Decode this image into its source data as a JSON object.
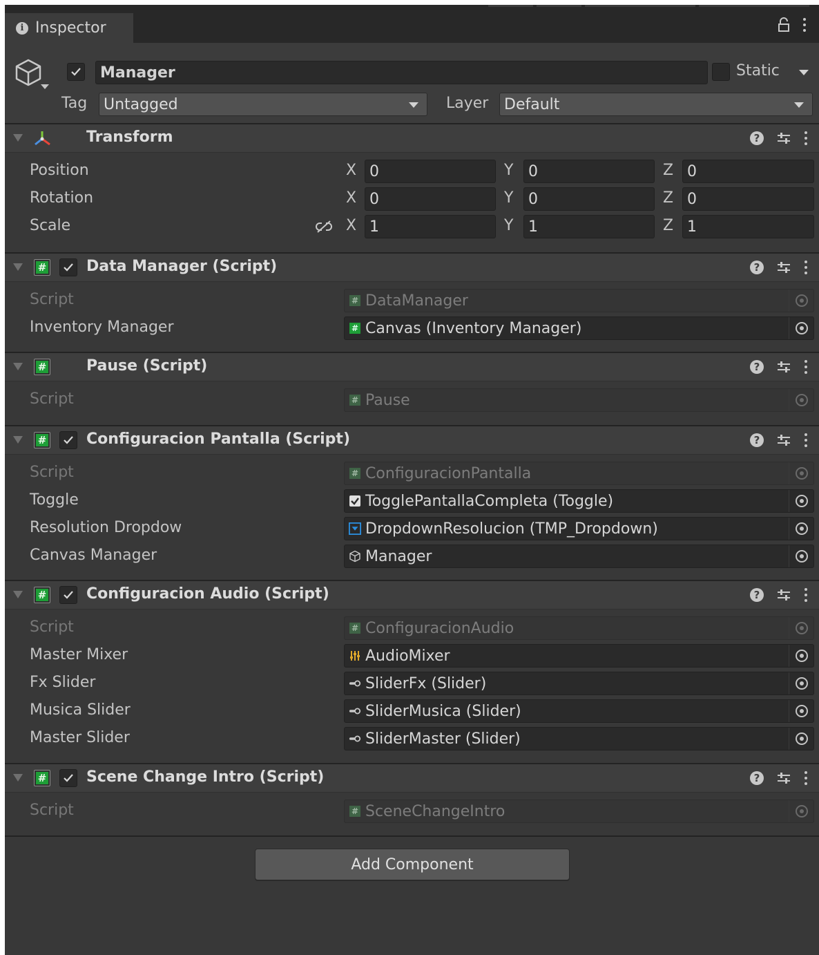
{
  "tab": {
    "title": "Inspector"
  },
  "gameobject": {
    "name": "Manager",
    "active": true,
    "static_label": "Static",
    "tag_label": "Tag",
    "tag_value": "Untagged",
    "layer_label": "Layer",
    "layer_value": "Default"
  },
  "transform": {
    "title": "Transform",
    "rows": [
      {
        "label": "Position",
        "x": "0",
        "y": "0",
        "z": "0"
      },
      {
        "label": "Rotation",
        "x": "0",
        "y": "0",
        "z": "0"
      },
      {
        "label": "Scale",
        "x": "1",
        "y": "1",
        "z": "1"
      }
    ],
    "axis_x": "X",
    "axis_y": "Y",
    "axis_z": "Z"
  },
  "components": [
    {
      "title": "Data Manager (Script)",
      "rows": [
        {
          "label": "Script",
          "value": "DataManager"
        },
        {
          "label": "Inventory Manager",
          "value": "Canvas (Inventory Manager)"
        }
      ]
    },
    {
      "title": "Pause (Script)",
      "rows": [
        {
          "label": "Script",
          "value": "Pause"
        }
      ]
    },
    {
      "title": "Configuracion Pantalla (Script)",
      "rows": [
        {
          "label": "Script",
          "value": "ConfiguracionPantalla"
        },
        {
          "label": "Toggle",
          "value": "TogglePantallaCompleta (Toggle)"
        },
        {
          "label": "Resolution Dropdow",
          "value": "DropdownResolucion (TMP_Dropdown)"
        },
        {
          "label": "Canvas Manager",
          "value": "Manager"
        }
      ]
    },
    {
      "title": "Configuracion Audio (Script)",
      "rows": [
        {
          "label": "Script",
          "value": "ConfiguracionAudio"
        },
        {
          "label": "Master Mixer",
          "value": "AudioMixer"
        },
        {
          "label": "Fx Slider",
          "value": "SliderFx (Slider)"
        },
        {
          "label": "Musica Slider",
          "value": "SliderMusica (Slider)"
        },
        {
          "label": "Master Slider",
          "value": "SliderMaster (Slider)"
        }
      ]
    },
    {
      "title": "Scene Change Intro (Script)",
      "rows": [
        {
          "label": "Script",
          "value": "SceneChangeIntro"
        }
      ]
    }
  ],
  "add_component_label": "Add Component",
  "colors": {
    "panel": "#383838",
    "header": "#3e3e3e",
    "field": "#2a2a2a",
    "script_green": "#1e9e37",
    "dropdown_blue": "#2b8fe0",
    "mixer_yellow": "#e0a82b"
  }
}
